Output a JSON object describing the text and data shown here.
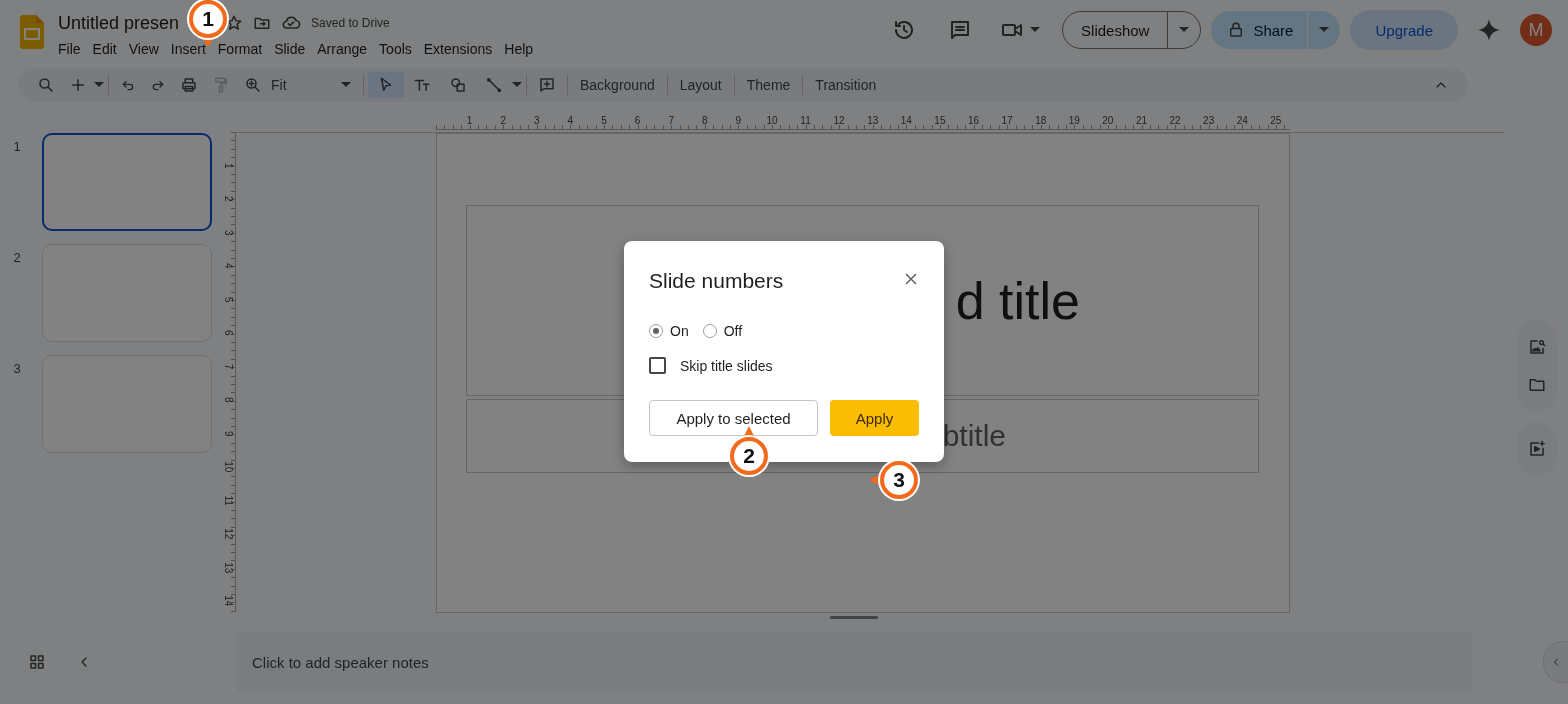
{
  "header": {
    "title": "Untitled presen",
    "saved_status": "Saved to Drive",
    "menu": [
      "File",
      "Edit",
      "View",
      "Insert",
      "Format",
      "Slide",
      "Arrange",
      "Tools",
      "Extensions",
      "Help"
    ],
    "slideshow_button": "Slideshow",
    "share_button": "Share",
    "upgrade_button": "Upgrade",
    "avatar": "M"
  },
  "toolbar": {
    "zoom": "Fit",
    "format_painter_disabled": true,
    "tools": [
      {
        "selected": true
      },
      {
        "selected": false
      },
      {
        "selected": false
      },
      {
        "selected": false
      }
    ],
    "buttons": [
      "Background",
      "Layout",
      "Theme",
      "Transition"
    ]
  },
  "filmstrip": [
    {
      "number": "1",
      "selected": true
    },
    {
      "number": "2",
      "selected": false
    },
    {
      "number": "3",
      "selected": false
    }
  ],
  "ruler_horizontal": [
    "1",
    "2",
    "3",
    "4",
    "5",
    "6",
    "7",
    "8",
    "9",
    "10",
    "11",
    "12",
    "13",
    "14",
    "15",
    "16",
    "17",
    "18",
    "19",
    "20",
    "21",
    "22",
    "23",
    "24",
    "25"
  ],
  "ruler_vertical": [
    "1",
    "2",
    "3",
    "4",
    "5",
    "6",
    "7",
    "8",
    "9",
    "10",
    "11",
    "12",
    "13",
    "14"
  ],
  "slide": {
    "title_visible": "d title",
    "subtitle_visible": "btitle"
  },
  "speaker_notes": {
    "placeholder": "Click to add speaker notes"
  },
  "dialog": {
    "title": "Slide numbers",
    "options": [
      {
        "label": "On",
        "selected": true
      },
      {
        "label": "Off",
        "selected": false
      }
    ],
    "skip_title_slides": {
      "label": "Skip title slides",
      "checked": false
    },
    "buttons": [
      {
        "label": "Apply to selected",
        "kind": "secondary"
      },
      {
        "label": "Apply",
        "kind": "primary"
      }
    ]
  },
  "callouts": [
    {
      "label": "1"
    },
    {
      "label": "2"
    },
    {
      "label": "3"
    }
  ]
}
